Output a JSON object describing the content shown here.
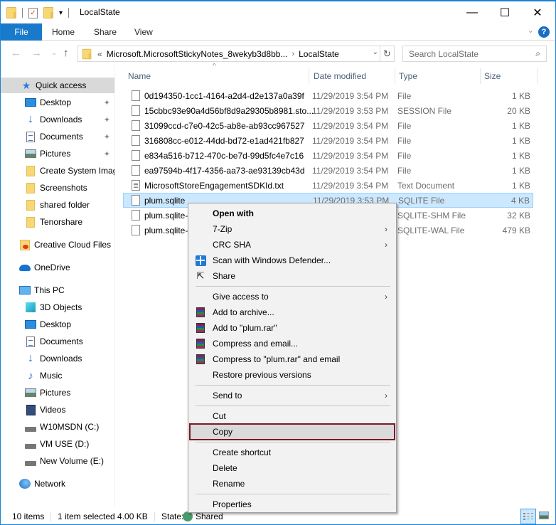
{
  "window": {
    "title": "LocalState",
    "controls": {
      "minimize": "—",
      "maximize": "☐",
      "close": "✕"
    }
  },
  "ribbon": {
    "tabs": [
      "File",
      "Home",
      "Share",
      "View"
    ],
    "help": "?",
    "expand": "⌄"
  },
  "navigation": {
    "back": "←",
    "forward": "→",
    "recent": "⌄",
    "up": "↑"
  },
  "address": {
    "overflow": "«",
    "crumbs": [
      "Microsoft.MicrosoftStickyNotes_8wekyb3d8bb...",
      "LocalState"
    ],
    "separator": "›",
    "dropdown": "⌄",
    "refresh": "↻"
  },
  "search": {
    "placeholder": "Search LocalState",
    "icon": "⚲"
  },
  "sidebar": {
    "items": [
      {
        "label": "Quick access",
        "icon": "star-icon",
        "pinned": false,
        "active": true
      },
      {
        "label": "Desktop",
        "icon": "desktop-icon",
        "pinned": true
      },
      {
        "label": "Downloads",
        "icon": "downloads-icon",
        "pinned": true
      },
      {
        "label": "Documents",
        "icon": "documents-icon",
        "pinned": true
      },
      {
        "label": "Pictures",
        "icon": "pictures-icon",
        "pinned": true
      },
      {
        "label": "Create System Imag",
        "icon": "folder-icon",
        "pinned": false
      },
      {
        "label": "Screenshots",
        "icon": "folder-icon",
        "pinned": false
      },
      {
        "label": "shared folder",
        "icon": "folder-icon",
        "pinned": false
      },
      {
        "label": "Tenorshare",
        "icon": "folder-icon",
        "pinned": false
      },
      {
        "label": "Creative Cloud Files",
        "icon": "creative-cloud-icon",
        "pinned": false
      },
      {
        "label": "OneDrive",
        "icon": "onedrive-icon",
        "pinned": false
      },
      {
        "label": "This PC",
        "icon": "this-pc-icon",
        "pinned": false
      },
      {
        "label": "3D Objects",
        "icon": "3d-objects-icon",
        "pinned": false
      },
      {
        "label": "Desktop",
        "icon": "desktop-icon",
        "pinned": false
      },
      {
        "label": "Documents",
        "icon": "documents-icon",
        "pinned": false
      },
      {
        "label": "Downloads",
        "icon": "downloads-icon",
        "pinned": false
      },
      {
        "label": "Music",
        "icon": "music-icon",
        "pinned": false
      },
      {
        "label": "Pictures",
        "icon": "pictures-icon",
        "pinned": false
      },
      {
        "label": "Videos",
        "icon": "videos-icon",
        "pinned": false
      },
      {
        "label": "W10MSDN (C:)",
        "icon": "drive-icon",
        "pinned": false
      },
      {
        "label": "VM USE (D:)",
        "icon": "drive-icon",
        "pinned": false
      },
      {
        "label": "New Volume (E:)",
        "icon": "drive-icon",
        "pinned": false
      },
      {
        "label": "Network",
        "icon": "network-icon",
        "pinned": false
      }
    ],
    "pin_glyph": "📌"
  },
  "file_list": {
    "columns": [
      "Name",
      "Date modified",
      "Type",
      "Size"
    ],
    "sort_indicator": "^",
    "rows": [
      {
        "name": "0d194350-1cc1-4164-a2d4-d2e137a0a39f",
        "date": "11/29/2019 3:54 PM",
        "type": "File",
        "size": "1 KB"
      },
      {
        "name": "15cbbc93e90a4d56bf8d9a29305b8981.sto...",
        "date": "11/29/2019 3:53 PM",
        "type": "SESSION File",
        "size": "20 KB"
      },
      {
        "name": "31099ccd-c7e0-42c5-ab8e-ab93cc967527",
        "date": "11/29/2019 3:54 PM",
        "type": "File",
        "size": "1 KB"
      },
      {
        "name": "316808cc-e012-44dd-bd72-e1ad421fb827",
        "date": "11/29/2019 3:54 PM",
        "type": "File",
        "size": "1 KB"
      },
      {
        "name": "e834a516-b712-470c-be7d-99d5fc4e7c16",
        "date": "11/29/2019 3:54 PM",
        "type": "File",
        "size": "1 KB"
      },
      {
        "name": "ea97594b-4f17-4356-aa73-ae93139cb43d",
        "date": "11/29/2019 3:54 PM",
        "type": "File",
        "size": "1 KB"
      },
      {
        "name": "MicrosoftStoreEngagementSDKId.txt",
        "date": "11/29/2019 3:54 PM",
        "type": "Text Document",
        "size": "1 KB"
      },
      {
        "name": "plum.sqlite",
        "date": "11/29/2019 3:53 PM",
        "type": "SQLITE File",
        "size": "4 KB",
        "selected": true
      },
      {
        "name": "plum.sqlite-",
        "date": "",
        "type": "SQLITE-SHM File",
        "size": "32 KB"
      },
      {
        "name": "plum.sqlite-",
        "date": "",
        "type": "SQLITE-WAL File",
        "size": "479 KB"
      }
    ]
  },
  "context_menu": {
    "items": [
      {
        "label": "Open with",
        "bold": true
      },
      {
        "label": "7-Zip",
        "submenu": true
      },
      {
        "label": "CRC SHA",
        "submenu": true
      },
      {
        "label": "Scan with Windows Defender...",
        "icon": "windows-defender-icon"
      },
      {
        "label": "Share",
        "icon": "share-icon"
      },
      {
        "label": "Give access to",
        "submenu": true
      },
      {
        "label": "Add to archive...",
        "icon": "winrar-icon"
      },
      {
        "label": "Add to \"plum.rar\"",
        "icon": "winrar-icon"
      },
      {
        "label": "Compress and email...",
        "icon": "winrar-icon"
      },
      {
        "label": "Compress to \"plum.rar\" and email",
        "icon": "winrar-icon"
      },
      {
        "label": "Restore previous versions"
      },
      {
        "label": "Send to",
        "submenu": true
      },
      {
        "label": "Cut"
      },
      {
        "label": "Copy",
        "highlighted": true
      },
      {
        "label": "Create shortcut"
      },
      {
        "label": "Delete"
      },
      {
        "label": "Rename"
      },
      {
        "label": "Properties"
      }
    ],
    "submenu_glyph": "›",
    "highlight_color": "#7b1a25"
  },
  "status_bar": {
    "item_count": "10 items",
    "selection": "1 item selected  4.00 KB",
    "state_label": "State:",
    "state_value": "Shared"
  },
  "colors": {
    "accent": "#1979ca",
    "selection_bg": "#cce8ff",
    "selection_border": "#99d1ff",
    "menu_bg": "#f2f2f2",
    "highlight_outline": "#7b1a25"
  }
}
